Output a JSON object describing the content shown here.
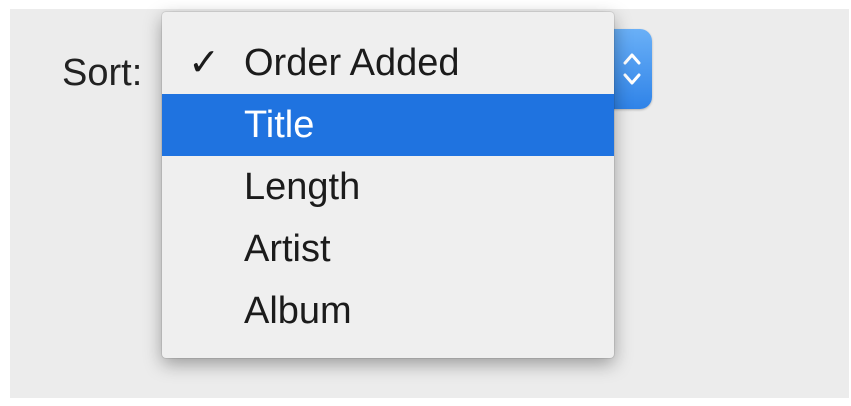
{
  "sort": {
    "label": "Sort:",
    "selected": "Order Added",
    "menu": [
      {
        "label": "Order Added",
        "checked": true,
        "highlighted": false
      },
      {
        "label": "Title",
        "checked": false,
        "highlighted": true
      },
      {
        "label": "Length",
        "checked": false,
        "highlighted": false
      },
      {
        "label": "Artist",
        "checked": false,
        "highlighted": false
      },
      {
        "label": "Album",
        "checked": false,
        "highlighted": false
      }
    ],
    "checkmark_glyph": "✓",
    "arrows_glyph": "⌃⌄"
  },
  "colors": {
    "background": "#ececec",
    "highlight": "#1f73e0",
    "popup_button": "#3b8ced"
  },
  "icons": {
    "checkmark": "checkmark-icon",
    "popup_arrows": "popup-arrows-icon"
  }
}
